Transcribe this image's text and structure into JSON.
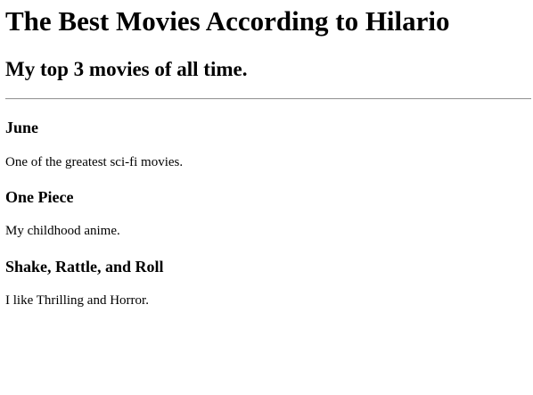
{
  "page": {
    "title": "The Best Movies According to Hilario",
    "subtitle": "My top 3 movies of all time."
  },
  "movies": [
    {
      "title": "June",
      "description": "One of the greatest sci-fi movies."
    },
    {
      "title": "One Piece",
      "description": "My childhood anime."
    },
    {
      "title": "Shake, Rattle, and Roll",
      "description": "I like Thrilling and Horror."
    }
  ]
}
